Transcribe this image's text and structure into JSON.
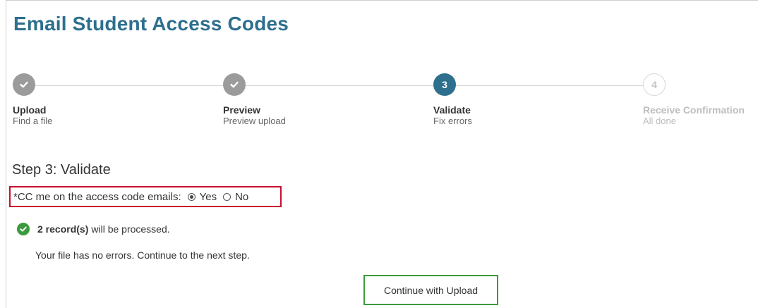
{
  "page": {
    "title": "Email Student Access Codes"
  },
  "stepper": {
    "steps": [
      {
        "number": "1",
        "title": "Upload",
        "subtitle": "Find a file",
        "state": "done",
        "icon": "checkmark-icon"
      },
      {
        "number": "2",
        "title": "Preview",
        "subtitle": "Preview upload",
        "state": "done",
        "icon": "checkmark-icon"
      },
      {
        "number": "3",
        "title": "Validate",
        "subtitle": "Fix errors",
        "state": "active"
      },
      {
        "number": "4",
        "title": "Receive Confirmation",
        "subtitle": "All done",
        "state": "pending"
      }
    ]
  },
  "step_section": {
    "heading": "Step 3: Validate"
  },
  "cc_option": {
    "label": "*CC me on the access code emails:",
    "options": [
      {
        "label": "Yes",
        "selected": true
      },
      {
        "label": "No",
        "selected": false
      }
    ]
  },
  "status": {
    "icon": "success-check-icon",
    "count_text": "2 record(s)",
    "message": "will be processed.",
    "note": "Your file has no errors. Continue to the next step."
  },
  "actions": {
    "continue_label": "Continue with Upload"
  },
  "colors": {
    "title": "#2e6f8e",
    "active_step": "#2e6f8e",
    "completed_step": "#9b9b9b",
    "pending_step_border": "#d8d8d8",
    "highlight_box": "#c8102e",
    "success": "#3c9a3e"
  }
}
